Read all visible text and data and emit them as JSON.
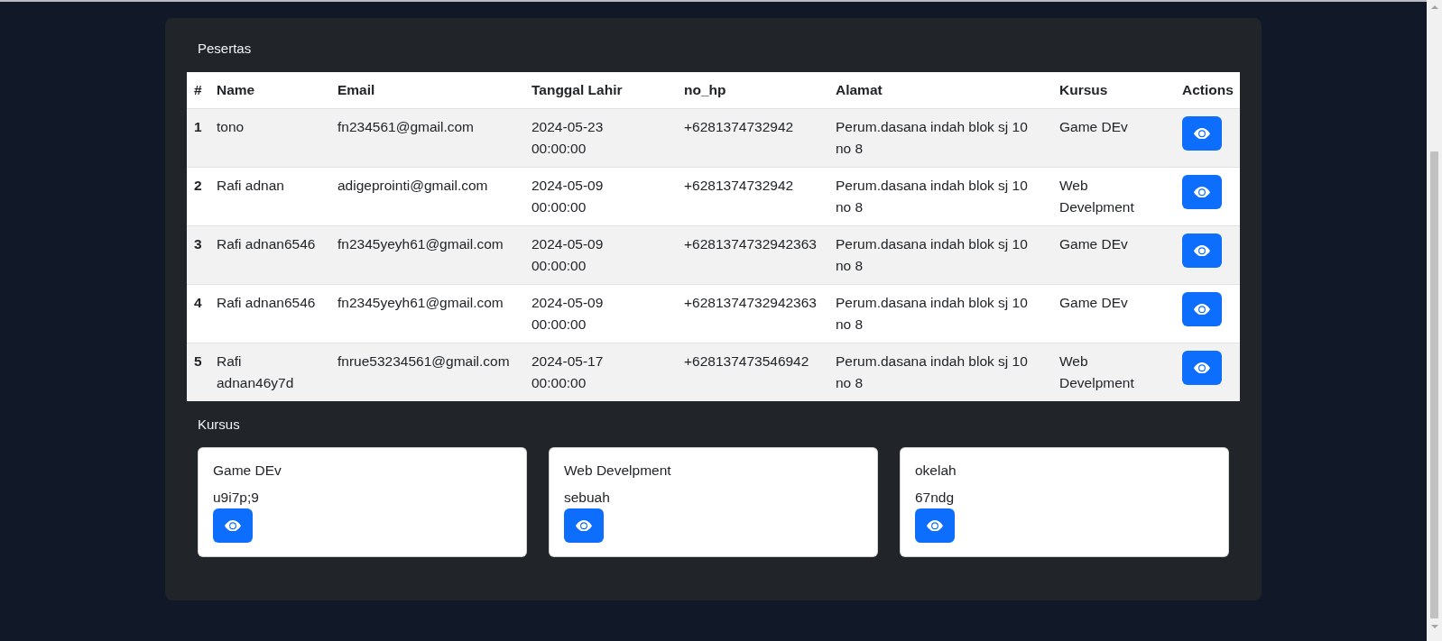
{
  "peserta_section": {
    "title": "Pesertas"
  },
  "table": {
    "columns": [
      "#",
      "Name",
      "Email",
      "Tanggal Lahir",
      "no_hp",
      "Alamat",
      "Kursus",
      "Actions"
    ],
    "rows": [
      {
        "number": "1",
        "name": "tono",
        "email": "fn234561@gmail.com",
        "tanggal_lahir": "2024-05-23 00:00:00",
        "no_hp": "+6281374732942",
        "alamat": "Perum.dasana indah blok sj 10 no 8",
        "kursus": "Game DEv"
      },
      {
        "number": "2",
        "name": "Rafi adnan",
        "email": "adigeprointi@gmail.com",
        "tanggal_lahir": "2024-05-09 00:00:00",
        "no_hp": "+6281374732942",
        "alamat": "Perum.dasana indah blok sj 10 no 8",
        "kursus": "Web Develpment"
      },
      {
        "number": "3",
        "name": "Rafi adnan6546",
        "email": "fn2345yeyh61@gmail.com",
        "tanggal_lahir": "2024-05-09 00:00:00",
        "no_hp": "+6281374732942363",
        "alamat": "Perum.dasana indah blok sj 10 no 8",
        "kursus": "Game DEv"
      },
      {
        "number": "4",
        "name": "Rafi adnan6546",
        "email": "fn2345yeyh61@gmail.com",
        "tanggal_lahir": "2024-05-09 00:00:00",
        "no_hp": "+6281374732942363",
        "alamat": "Perum.dasana indah blok sj 10 no 8",
        "kursus": "Game DEv"
      },
      {
        "number": "5",
        "name": "Rafi adnan46y7d",
        "email": "fnrue53234561@gmail.com",
        "tanggal_lahir": "2024-05-17 00:00:00",
        "no_hp": "+628137473546942",
        "alamat": "Perum.dasana indah blok sj 10 no 8",
        "kursus": "Web Develpment"
      }
    ]
  },
  "kursus_section": {
    "title": "Kursus",
    "cards": [
      {
        "title": "Game DEv",
        "description": "u9i7p;9"
      },
      {
        "title": "Web Develpment",
        "description": "sebuah"
      },
      {
        "title": "okelah",
        "description": "67ndg"
      }
    ]
  }
}
